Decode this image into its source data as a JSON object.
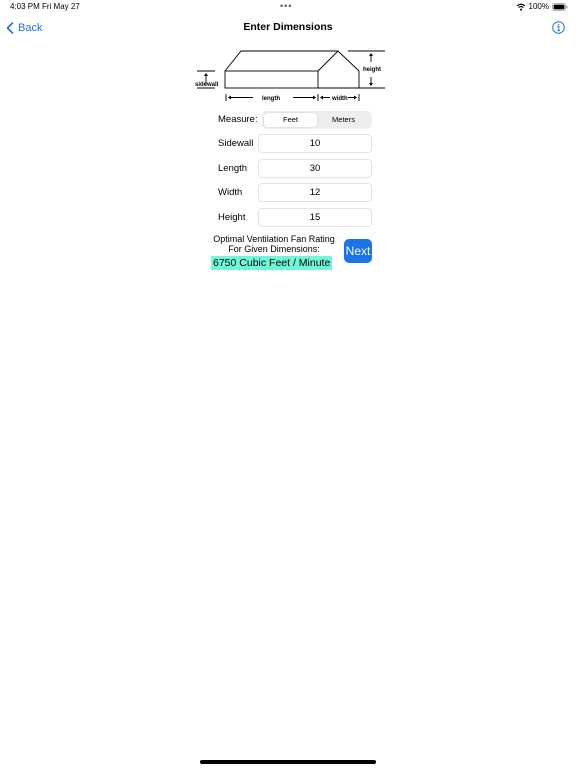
{
  "status": {
    "time": "4:03 PM",
    "date": "Fri May 27",
    "battery": "100%"
  },
  "nav": {
    "back_label": "Back",
    "title": "Enter Dimensions"
  },
  "diagram": {
    "sidewall": "sidewall",
    "length": "length",
    "width": "width",
    "height": "height"
  },
  "measure": {
    "label": "Measure:",
    "options": [
      "Feet",
      "Meters"
    ],
    "selected": "Feet"
  },
  "fields": {
    "sidewall": {
      "label": "Sidewall",
      "value": "10"
    },
    "length": {
      "label": "Length",
      "value": "30"
    },
    "width": {
      "label": "Width",
      "value": "12"
    },
    "height": {
      "label": "Height",
      "value": "15"
    }
  },
  "result": {
    "line1": "Optimal Ventilation Fan Rating",
    "line2": "For Given Dimensions:",
    "value": "6750 Cubic Feet / Minute"
  },
  "next_label": "Next",
  "colors": {
    "accent": "#1a73e8",
    "highlight": "#6ff7d9"
  },
  "icons": {
    "back": "chevron-left-icon",
    "info": "info-icon",
    "wifi": "wifi-icon",
    "battery": "battery-icon"
  }
}
